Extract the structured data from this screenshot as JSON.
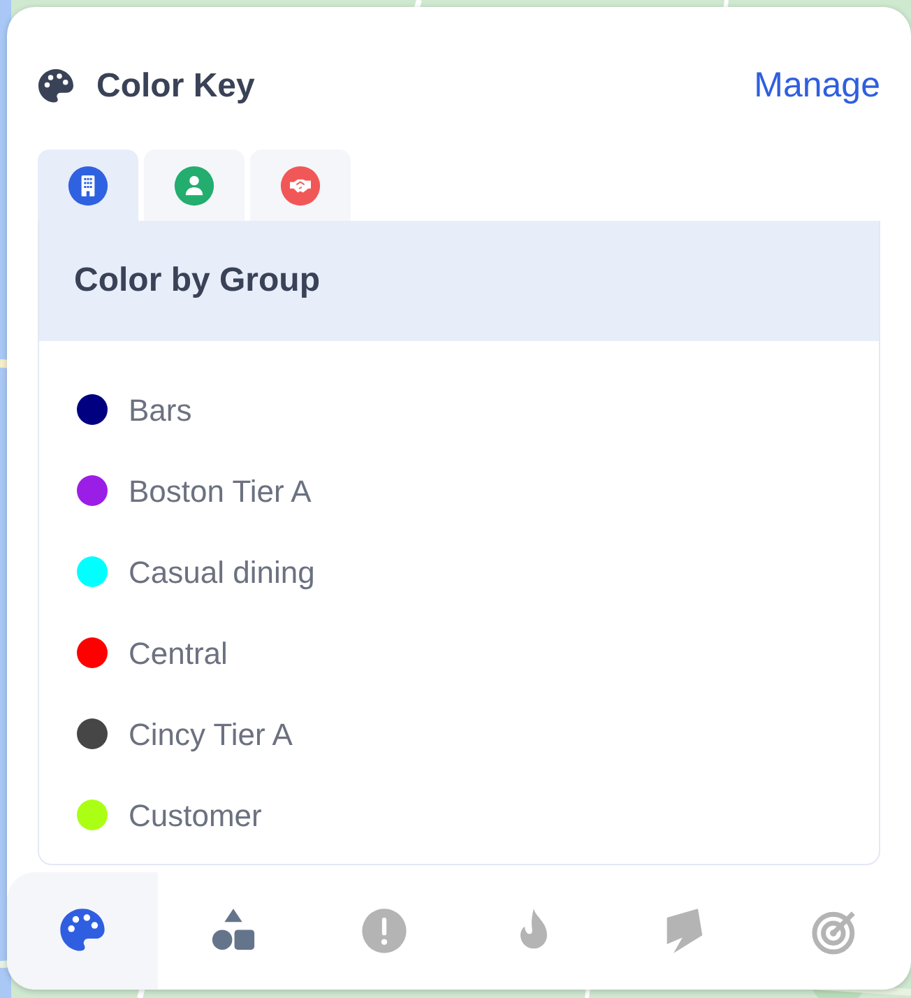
{
  "header": {
    "title": "Color Key",
    "action": "Manage"
  },
  "tabs": [
    {
      "kind": "building",
      "selected": true
    },
    {
      "kind": "person",
      "selected": false
    },
    {
      "kind": "handshake",
      "selected": false
    }
  ],
  "group_title": "Color by Group",
  "legend": [
    {
      "label": "Bars",
      "color": "#000080"
    },
    {
      "label": "Boston Tier A",
      "color": "#9b1ee6"
    },
    {
      "label": "Casual dining",
      "color": "#00ffff"
    },
    {
      "label": "Central",
      "color": "#ff0000"
    },
    {
      "label": "Cincy Tier A",
      "color": "#464646"
    },
    {
      "label": "Customer",
      "color": "#aaff14"
    }
  ],
  "toolbar": [
    {
      "kind": "palette",
      "selected": true,
      "disabled": false
    },
    {
      "kind": "shapes",
      "selected": false,
      "disabled": false
    },
    {
      "kind": "alert",
      "selected": false,
      "disabled": true
    },
    {
      "kind": "flame",
      "selected": false,
      "disabled": true
    },
    {
      "kind": "layers",
      "selected": false,
      "disabled": true
    },
    {
      "kind": "target",
      "selected": false,
      "disabled": true
    }
  ]
}
